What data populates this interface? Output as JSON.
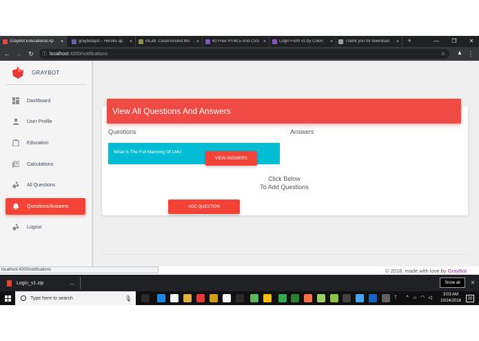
{
  "browser": {
    "tabs": [
      {
        "label": "GrayBot Educational Ap",
        "favicon_color": "#e8453c",
        "active": true
      },
      {
        "label": "graybotapi1 - Heroku ap",
        "favicon_color": "#6762a6",
        "active": false
      },
      {
        "label": "mLab: Cloud-hosted Mo",
        "favicon_color": "#8d9148",
        "active": false
      },
      {
        "label": "60 Free HTML5 And CSS",
        "favicon_color": "#7e57c2",
        "active": false
      },
      {
        "label": "Login Form v1 by Colorl",
        "favicon_color": "#7e57c2",
        "active": false
      },
      {
        "label": "Thank you for download",
        "favicon_color": "#9e9e9e",
        "active": false
      }
    ],
    "close_glyph": "×",
    "new_tab_glyph": "+",
    "url_host": "localhost",
    "url_path": ":4200/notifications",
    "status_url": "localhost:4200/notifications"
  },
  "sidebar": {
    "brand": "GRAYBOT",
    "items": [
      {
        "label": "Dashboard",
        "icon": "dashboard-icon",
        "active": false
      },
      {
        "label": "User Profile",
        "icon": "person-icon",
        "active": false
      },
      {
        "label": "Education",
        "icon": "clipboard-icon",
        "active": false
      },
      {
        "label": "Calculations",
        "icon": "library-books-icon",
        "active": false
      },
      {
        "label": "All Questions",
        "icon": "bubble-chart-icon",
        "active": false
      },
      {
        "label": "Questions/Answers",
        "icon": "notifications-icon",
        "active": true
      },
      {
        "label": "Logout",
        "icon": "bubble-chart-icon",
        "active": false
      }
    ]
  },
  "main": {
    "card_title": "View All Questions And Answers",
    "questions_heading": "Questions",
    "answers_heading": "Answers",
    "question_text": "What Is The Full Manning Of LMU",
    "view_answers_label": "VIEW ANSWERS",
    "click_below_line1": "Click Below",
    "click_below_line2": "To Add Questions",
    "add_question_label": "ADD QUESTION"
  },
  "footer": {
    "text": "© 2018, made with love by ",
    "brand": "GrayBot"
  },
  "downloads": {
    "file_name": "Login_v1.zip",
    "show_all_label": "Show all"
  },
  "taskbar": {
    "search_placeholder": "Type here to search",
    "time": "3:03 AM",
    "date": "10/24/2018",
    "notification_count": "20"
  },
  "colors": {
    "accent_red": "#f44336",
    "question_cyan": "#00bcd4",
    "brand_purple": "#9c27b0"
  }
}
